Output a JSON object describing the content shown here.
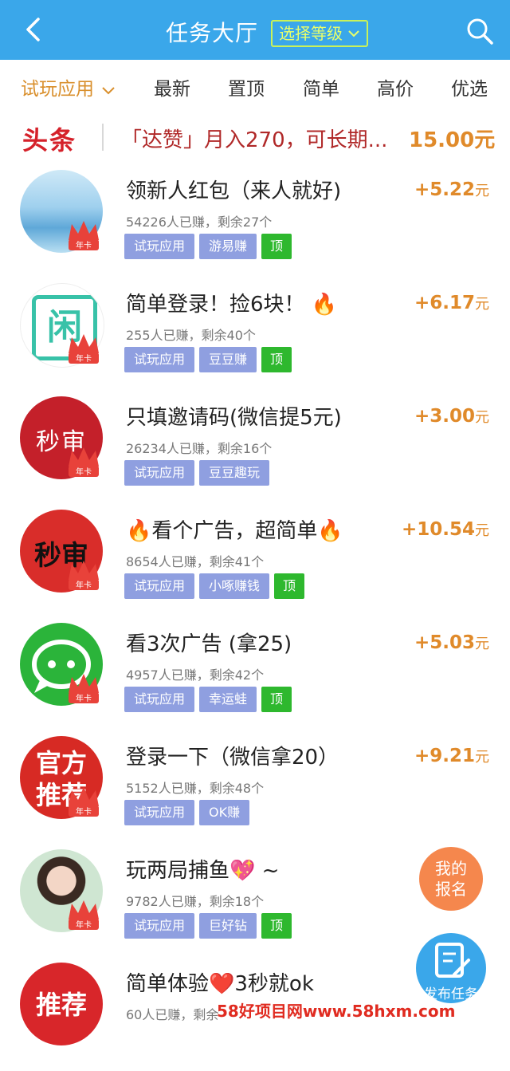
{
  "header": {
    "title": "任务大厅",
    "level_button": "选择等级",
    "back_icon": "back-chevron-icon",
    "search_icon": "search-icon"
  },
  "tabs": [
    "试玩应用",
    "最新",
    "置顶",
    "简单",
    "高价",
    "优选"
  ],
  "headline": {
    "tag": "头条",
    "text": "「达赞」月入270，可长期...",
    "reward": "15.00元"
  },
  "tasks": [
    {
      "title": "领新人红包（来人就好)",
      "stats": "54226人已赚，剩余27个",
      "chips": [
        "试玩应用",
        "游易赚"
      ],
      "top": "顶",
      "reward": "+5.22",
      "unit": "元",
      "badge": "年卡"
    },
    {
      "title": "简单登录！捡6块！ 🔥",
      "stats": "255人已赚，剩余40个",
      "chips": [
        "试玩应用",
        "豆豆赚"
      ],
      "top": "顶",
      "reward": "+6.17",
      "unit": "元",
      "badge": "年卡",
      "avatar_text": "闲"
    },
    {
      "title": "只填邀请码(微信提5元)",
      "stats": "26234人已赚，剩余16个",
      "chips": [
        "试玩应用",
        "豆豆趣玩"
      ],
      "top": "",
      "reward": "+3.00",
      "unit": "元",
      "badge": "年卡",
      "avatar_text": "秒审"
    },
    {
      "title": "🔥看个广告，超简单🔥",
      "stats": "8654人已赚，剩余41个",
      "chips": [
        "试玩应用",
        "小啄赚钱"
      ],
      "top": "顶",
      "reward": "+10.54",
      "unit": "元",
      "badge": "年卡",
      "avatar_text": "秒审"
    },
    {
      "title": "看3次广告 (拿25)",
      "stats": "4957人已赚，剩余42个",
      "chips": [
        "试玩应用",
        "幸运蛙"
      ],
      "top": "顶",
      "reward": "+5.03",
      "unit": "元",
      "badge": "年卡"
    },
    {
      "title": "登录一下（微信拿20）",
      "stats": "5152人已赚，剩余48个",
      "chips": [
        "试玩应用",
        "OK赚"
      ],
      "top": "",
      "reward": "+9.21",
      "unit": "元",
      "badge": "年卡",
      "avatar_text": "官方推荐"
    },
    {
      "title": "玩两局捕鱼💖 ~",
      "stats": "9782人已赚，剩余18个",
      "chips": [
        "试玩应用",
        "巨好钻"
      ],
      "top": "顶",
      "reward": "",
      "unit": "",
      "badge": "年卡"
    },
    {
      "title": "简单体验❤️3秒就ok",
      "stats": "60人已赚，剩余",
      "chips": [],
      "top": "",
      "reward": "",
      "unit": "",
      "badge": "",
      "avatar_text": "推荐"
    }
  ],
  "float": {
    "mine": "我的报名",
    "publish": "发布任务"
  },
  "watermark": "58好项目网www.58hxm.com",
  "colors": {
    "header_bg": "#3aa7ea",
    "accent": "#e08a2a",
    "chip": "#8f9fe0",
    "top_chip": "#2eb82e",
    "headline_red": "#d5212a"
  }
}
